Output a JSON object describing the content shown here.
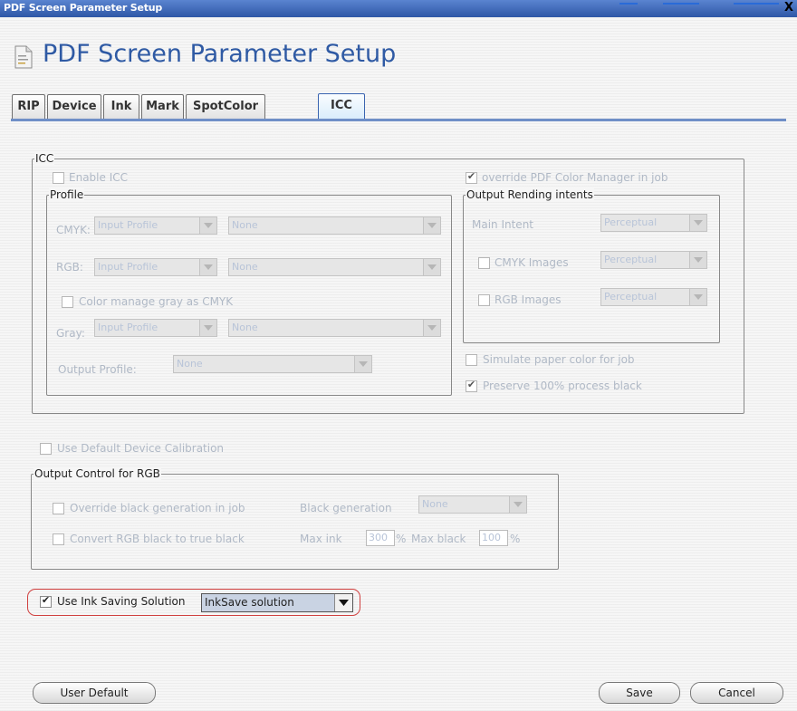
{
  "window": {
    "title": "PDF Screen Parameter Setup",
    "close_glyph": "X"
  },
  "header": {
    "title": "PDF Screen Parameter Setup",
    "icon": "document-icon"
  },
  "tabs": [
    {
      "label": "RIP",
      "active": false
    },
    {
      "label": "Device",
      "active": false
    },
    {
      "label": "Ink",
      "active": false
    },
    {
      "label": "Mark",
      "active": false
    },
    {
      "label": "SpotColor",
      "active": false
    },
    {
      "label": "ICC",
      "active": true
    }
  ],
  "icc": {
    "legend": "ICC",
    "enable_icc": {
      "label": "Enable ICC",
      "checked": false
    },
    "override_pdf": {
      "label": "override PDF Color Manager in job",
      "checked": true
    },
    "profile": {
      "legend": "Profile",
      "cmyk": {
        "label": "CMYK:",
        "type": "Input Profile",
        "value": "None"
      },
      "rgb": {
        "label": "RGB:",
        "type": "Input Profile",
        "value": "None"
      },
      "color_manage_gray": {
        "label": "Color manage gray as CMYK",
        "checked": false
      },
      "gray": {
        "label": "Gray:",
        "type": "Input Profile",
        "value": "None"
      },
      "output_profile": {
        "label": "Output Profile:",
        "value": "None"
      }
    },
    "intents": {
      "legend": "Output Rending intents",
      "main": {
        "label": "Main Intent",
        "value": "Perceptual"
      },
      "cmyk_images": {
        "label": "CMYK Images",
        "value": "Perceptual",
        "checked": false
      },
      "rgb_images": {
        "label": "RGB Images",
        "value": "Perceptual",
        "checked": false
      }
    },
    "simulate_paper": {
      "label": "Simulate paper color for job",
      "checked": false
    },
    "preserve_black": {
      "label": "Preserve 100% process black",
      "checked": true
    }
  },
  "use_default_calibration": {
    "label": "Use Default Device Calibration",
    "checked": false
  },
  "output_control": {
    "legend": "Output Control for RGB",
    "override_black": {
      "label": "Override black generation in job",
      "checked": false
    },
    "black_generation": {
      "label": "Black generation",
      "value": "None"
    },
    "convert_black": {
      "label": "Convert RGB black to true black",
      "checked": false
    },
    "max_ink": {
      "label": "Max ink",
      "value": "300",
      "unit": "%"
    },
    "max_black": {
      "label": "Max black",
      "value": "100",
      "unit": "%"
    }
  },
  "ink_saving": {
    "label": "Use Ink Saving Solution",
    "checked": true,
    "value": "InkSave solution"
  },
  "buttons": {
    "user_default": "User Default",
    "save": "Save",
    "cancel": "Cancel"
  },
  "colors": {
    "titlebar": "#3f68b6",
    "heading": "#2f5aa4",
    "highlight": "#d0403f",
    "disabled_text": "#b0b9c6"
  }
}
